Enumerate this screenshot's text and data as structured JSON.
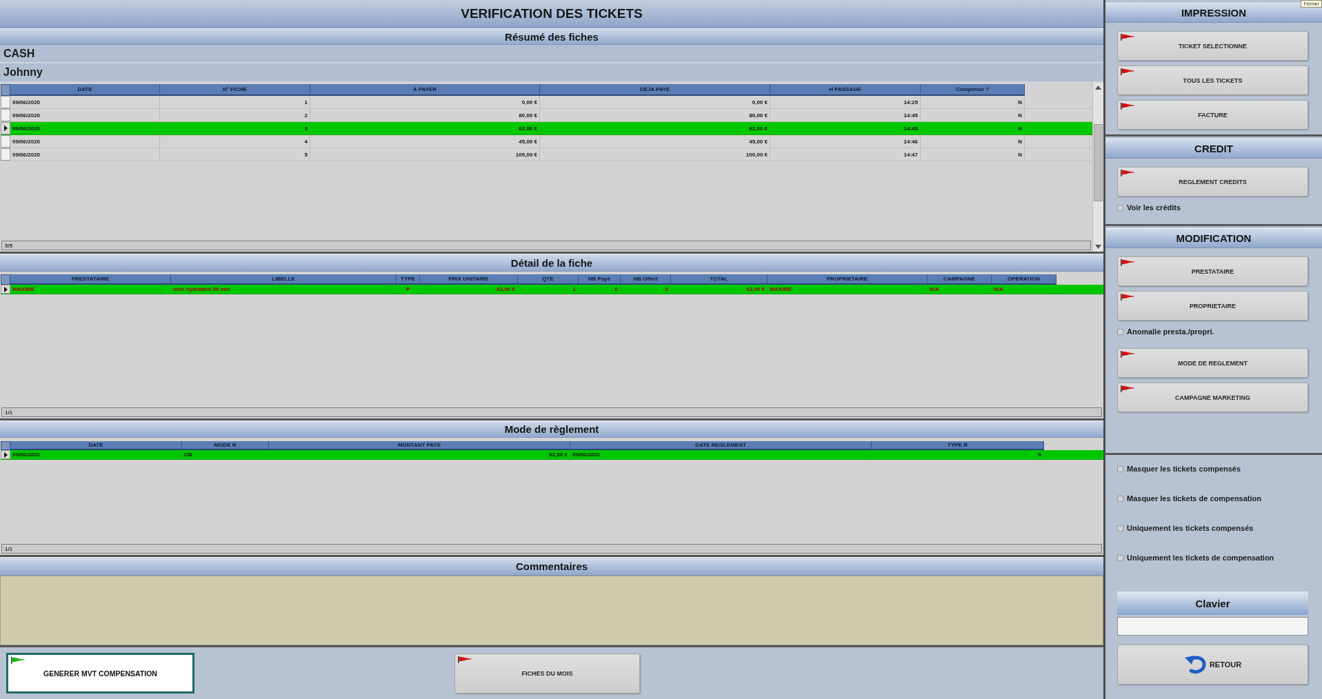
{
  "window": {
    "title": "VERIFICATION DES TICKETS"
  },
  "summary": {
    "title": "Résumé des fiches",
    "account": "CASH",
    "customer": "Johnny",
    "table": {
      "columns": [
        {
          "label": "DATE",
          "kind": "text"
        },
        {
          "label": "N° FICHE",
          "kind": "number"
        },
        {
          "label": "A PAYER",
          "kind": "number"
        },
        {
          "label": "DEJA PAYE",
          "kind": "number"
        },
        {
          "label": "H PASSAGE",
          "kind": "number"
        },
        {
          "label": "Compensé ?",
          "kind": "number"
        }
      ],
      "rows": [
        {
          "selected": false,
          "cells": [
            "09/06/2020",
            "1",
            "0,00 €",
            "0,00 €",
            "14:25",
            "N"
          ]
        },
        {
          "selected": false,
          "cells": [
            "09/06/2020",
            "2",
            "80,00 €",
            "80,00 €",
            "14:45",
            "N"
          ]
        },
        {
          "selected": true,
          "cells": [
            "09/06/2020",
            "3",
            "62,00 €",
            "62,00 €",
            "14:45",
            "N"
          ]
        },
        {
          "selected": false,
          "cells": [
            "09/06/2020",
            "4",
            "45,00 €",
            "45,00 €",
            "14:46",
            "N"
          ]
        },
        {
          "selected": false,
          "cells": [
            "09/06/2020",
            "5",
            "100,00 €",
            "100,00 €",
            "14:47",
            "N"
          ]
        }
      ],
      "footer": "5/5"
    }
  },
  "detail": {
    "title": "Détail de la fiche",
    "table": {
      "columns": [
        {
          "label": "PRESTATAIRE",
          "kind": "text"
        },
        {
          "label": "LIBELLE",
          "kind": "text"
        },
        {
          "label": "TYPE",
          "kind": "code"
        },
        {
          "label": "PRIX UNITAIRE",
          "kind": "number"
        },
        {
          "label": "QTE",
          "kind": "number"
        },
        {
          "label": "NB Payé",
          "kind": "number"
        },
        {
          "label": "NB Offert",
          "kind": "number"
        },
        {
          "label": "TOTAL",
          "kind": "number"
        },
        {
          "label": "PROPRIETAIRE",
          "kind": "text"
        },
        {
          "label": "CAMPAGNE",
          "kind": "text"
        },
        {
          "label": "OPERATION",
          "kind": "text"
        }
      ],
      "rows": [
        {
          "selected": true,
          "cells": [
            "MAXIME",
            "soin hydratant 30 min",
            "P",
            "62,00 €",
            "1",
            "0",
            "0",
            "62,00 €",
            "MAXIME",
            "N/A",
            "N/A"
          ]
        }
      ],
      "footer": "1/1"
    }
  },
  "payment": {
    "title": "Mode de règlement",
    "table": {
      "columns": [
        {
          "label": "DATE",
          "kind": "text"
        },
        {
          "label": "MODE R",
          "kind": "text"
        },
        {
          "label": "MONTANT PAYE",
          "kind": "number"
        },
        {
          "label": "DATE REGLEMENT",
          "kind": "text"
        },
        {
          "label": "TYPE R",
          "kind": "number"
        }
      ],
      "rows": [
        {
          "selected": true,
          "cells": [
            "09/06/2020",
            "CB",
            "62,00 €",
            "09/06/2020",
            "0"
          ]
        }
      ],
      "footer": "1/1"
    }
  },
  "comments": {
    "title": "Commentaires"
  },
  "bottom_buttons": [
    {
      "label": "GENERER MVT COMPENSATION",
      "focused": true
    },
    {
      "label": "FICHES DU MOIS",
      "focused": false
    }
  ],
  "side_panel": {
    "tooltip": "Fermer",
    "sections": [
      {
        "title": "IMPRESSION",
        "items": [
          {
            "kind": "button",
            "label": "TICKET SELECTIONNE"
          },
          {
            "kind": "button",
            "label": "TOUS LES TICKETS"
          },
          {
            "kind": "button",
            "label": "FACTURE"
          }
        ]
      },
      {
        "title": "CREDIT",
        "items": [
          {
            "kind": "button",
            "label": "REGLEMENT CREDITS"
          },
          {
            "kind": "checkbox",
            "label": "Voir les crédits",
            "checked": false
          }
        ]
      },
      {
        "title": "MODIFICATION",
        "items": [
          {
            "kind": "button",
            "label": "PRESTATAIRE"
          },
          {
            "kind": "button",
            "label": "PROPRIETAIRE"
          },
          {
            "kind": "checkbox",
            "label": "Anomalie presta./propri.",
            "checked": false
          },
          {
            "kind": "button",
            "label": "MODE DE REGLEMENT"
          },
          {
            "kind": "button",
            "label": "CAMPAGNE MARKETING"
          }
        ]
      },
      {
        "items": [
          {
            "kind": "checkbox",
            "label": "Masquer les tickets compensés",
            "checked": false
          },
          {
            "kind": "checkbox",
            "label": "Masquer les tickets de compensation",
            "checked": false
          },
          {
            "kind": "checkbox",
            "label": "Uniquement les tickets compensés",
            "checked": false
          },
          {
            "kind": "checkbox",
            "label": "Uniquement les tickets de compensation",
            "checked": false
          }
        ]
      }
    ],
    "keyboard": {
      "title": "Clavier"
    },
    "back_button": {
      "label": "RETOUR"
    }
  }
}
